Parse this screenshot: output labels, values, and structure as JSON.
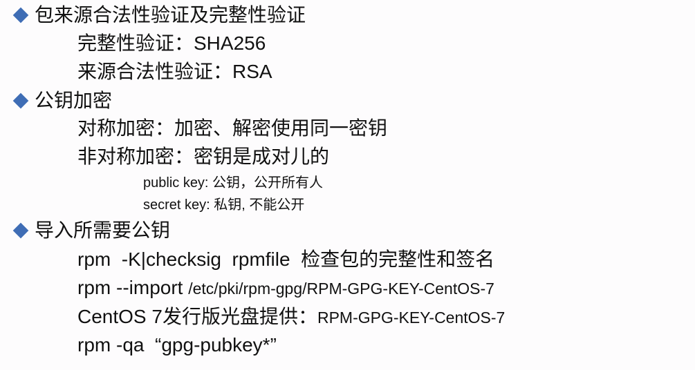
{
  "colors": {
    "bullet": "#3f6db5",
    "text": "#111111",
    "background": "#fdfcfd"
  },
  "sections": [
    {
      "heading": "包来源合法性验证及完整性验证",
      "items": [
        "完整性验证：SHA256",
        "来源合法性验证：RSA"
      ]
    },
    {
      "heading": "公钥加密",
      "items": [
        "对称加密：加密、解密使用同一密钥",
        "非对称加密：密钥是成对儿的"
      ],
      "subitems": [
        "public key: 公钥，公开所有人",
        "secret key: 私钥, 不能公开"
      ]
    },
    {
      "heading": "导入所需要公钥",
      "items": [
        {
          "main": "rpm  -K|checksig  rpmfile  检查包的完整性和签名"
        },
        {
          "main": "rpm --import ",
          "small": "/etc/pki/rpm-gpg/RPM-GPG-KEY-CentOS-7"
        },
        {
          "main": "CentOS 7发行版光盘提供：",
          "small": "RPM-GPG-KEY-CentOS-7"
        },
        {
          "main": "rpm -qa  “gpg-pubkey*”"
        }
      ]
    }
  ]
}
